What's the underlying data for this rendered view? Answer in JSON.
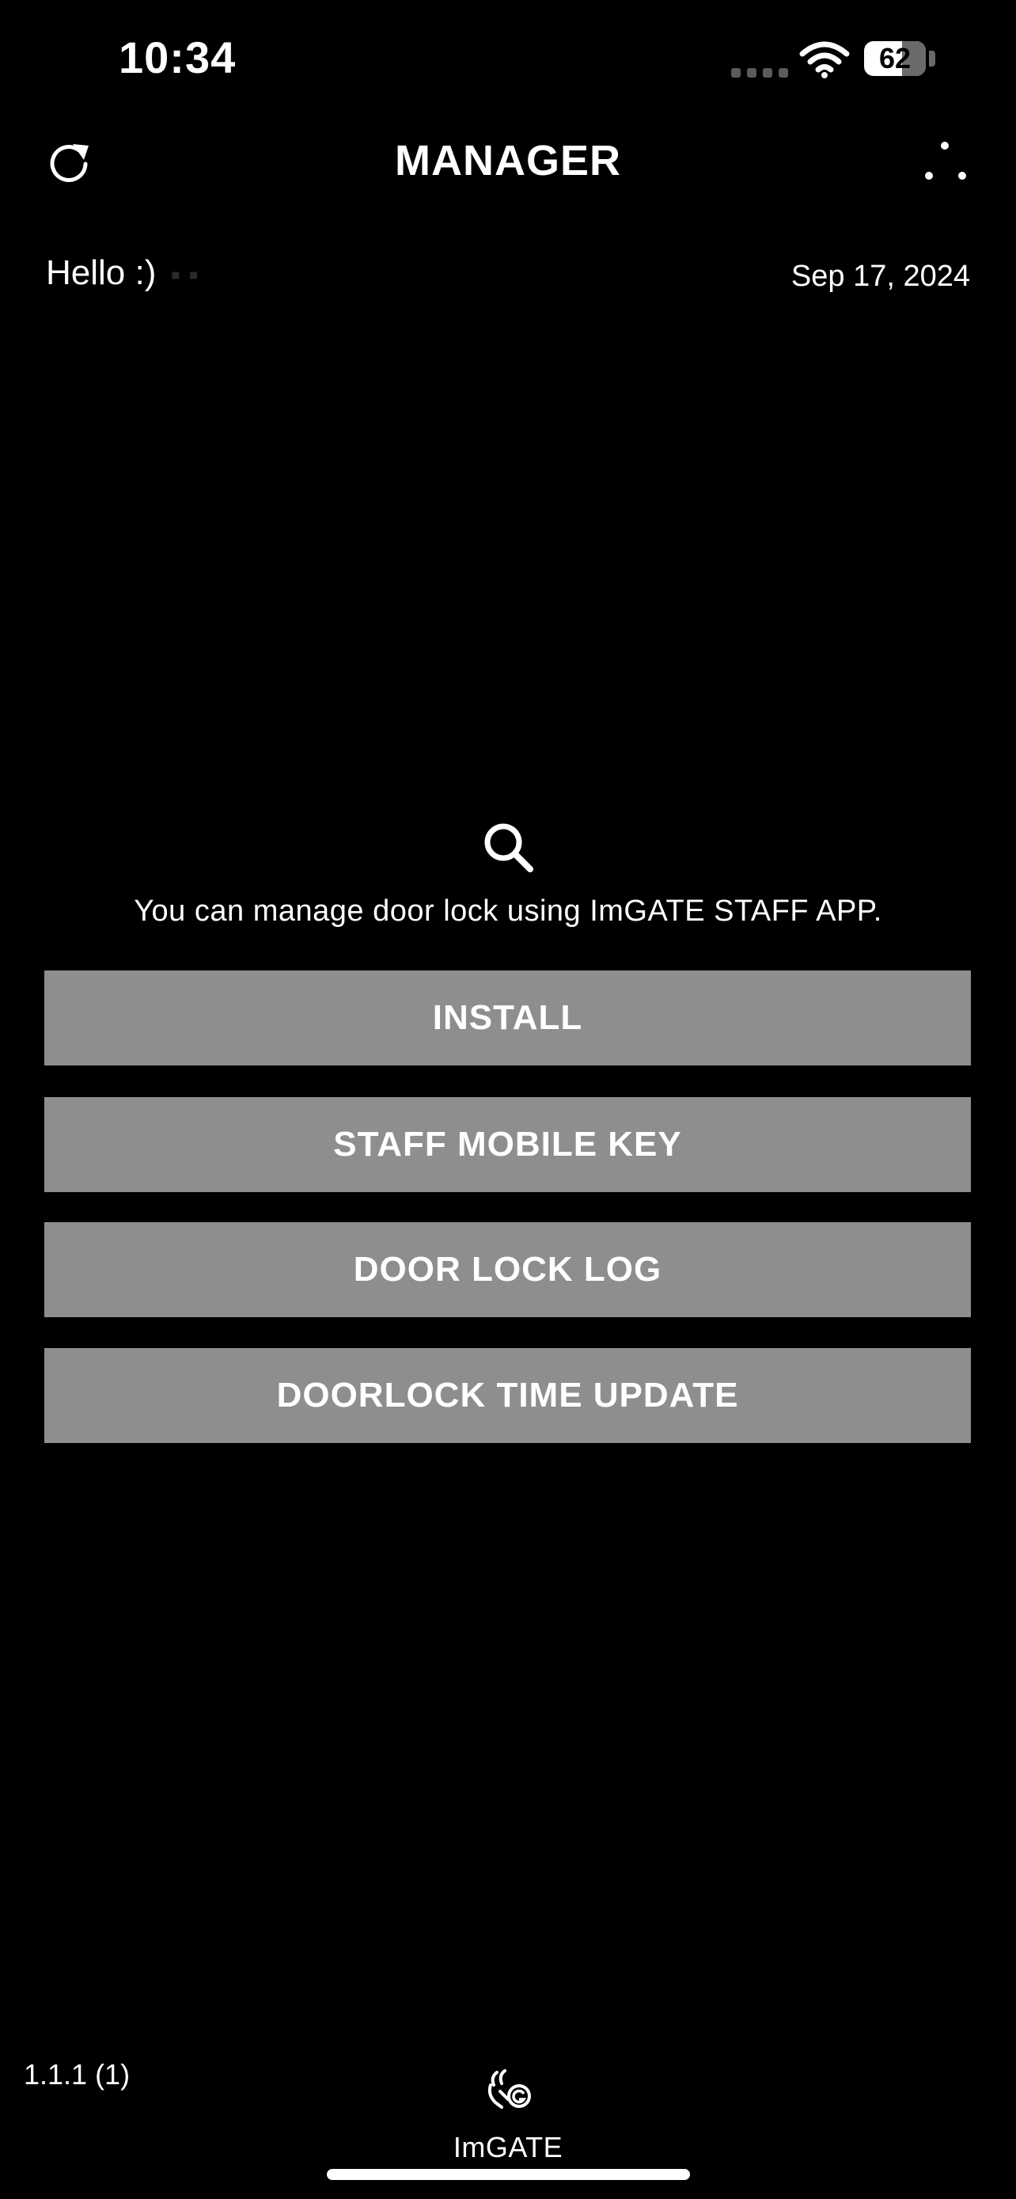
{
  "status_bar": {
    "time": "10:34",
    "battery_level": "62",
    "battery_fraction": 0.62
  },
  "header": {
    "title": "MANAGER",
    "refresh_icon": "refresh-icon",
    "more_icon": "more-dots-icon"
  },
  "greeting": {
    "text": "Hello :)",
    "date": "Sep 17, 2024"
  },
  "info": {
    "icon": "search-icon",
    "message": "You can manage door lock using ImGATE STAFF APP."
  },
  "buttons": {
    "install": "INSTALL",
    "staff_mobile_key": "STAFF MOBILE KEY",
    "door_lock_log": "DOOR LOCK LOG",
    "doorlock_time_update": "DOORLOCK TIME UPDATE"
  },
  "footer": {
    "version": "1.1.1 (1)",
    "brand": "ImGATE",
    "brand_icon": "imgate-logo-icon"
  },
  "colors": {
    "background": "#000000",
    "text": "#ffffff",
    "button_background": "#8e8e8e"
  }
}
